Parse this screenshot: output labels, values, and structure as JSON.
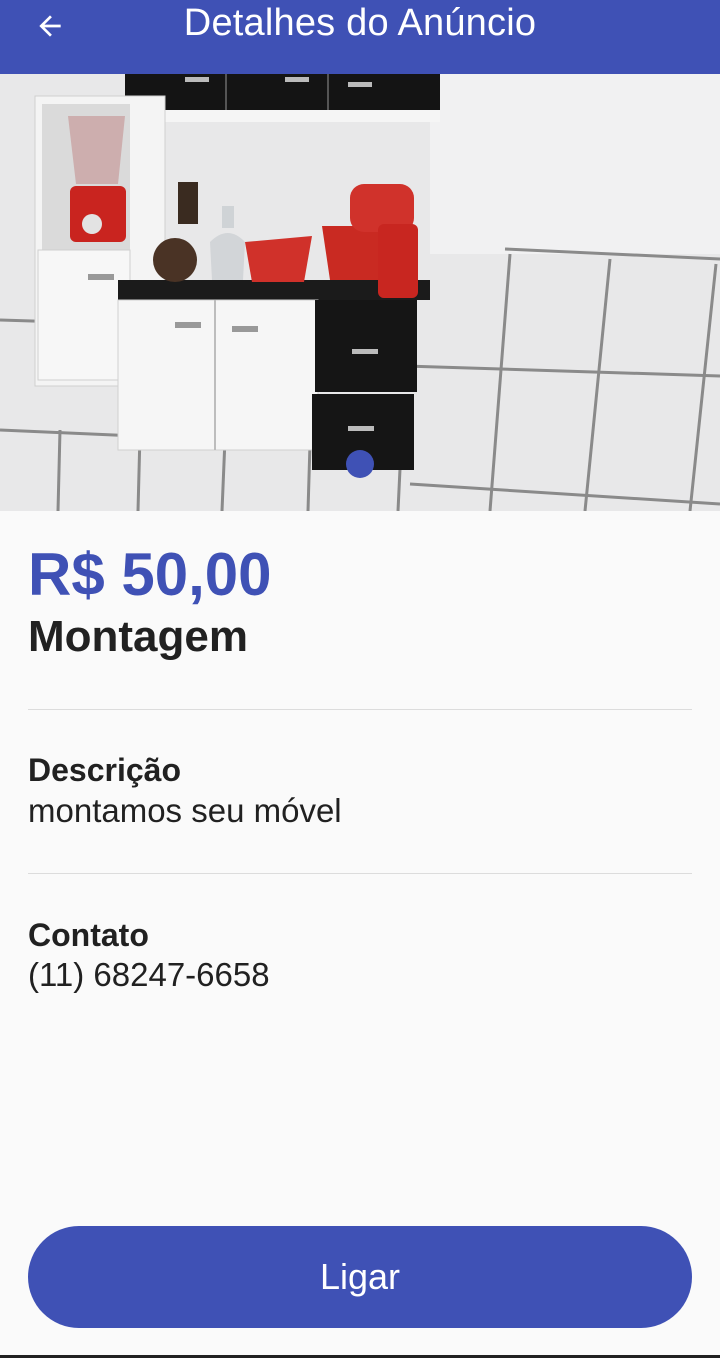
{
  "appbar": {
    "title": "Detalhes do Anúncio",
    "back_icon": "arrow-back-icon"
  },
  "gallery": {
    "image_subject": "kitchen-cabinet-photo",
    "page_indicator_count": 1,
    "active_index": 0
  },
  "listing": {
    "price": "R$ 50,00",
    "name": "Montagem"
  },
  "description": {
    "label": "Descrição",
    "text": "montamos seu móvel"
  },
  "contact": {
    "label": "Contato",
    "phone": "(11) 68247-6658"
  },
  "actions": {
    "call_label": "Ligar"
  },
  "colors": {
    "primary": "#3f51b5",
    "text": "#212121",
    "background": "#fafafa"
  }
}
